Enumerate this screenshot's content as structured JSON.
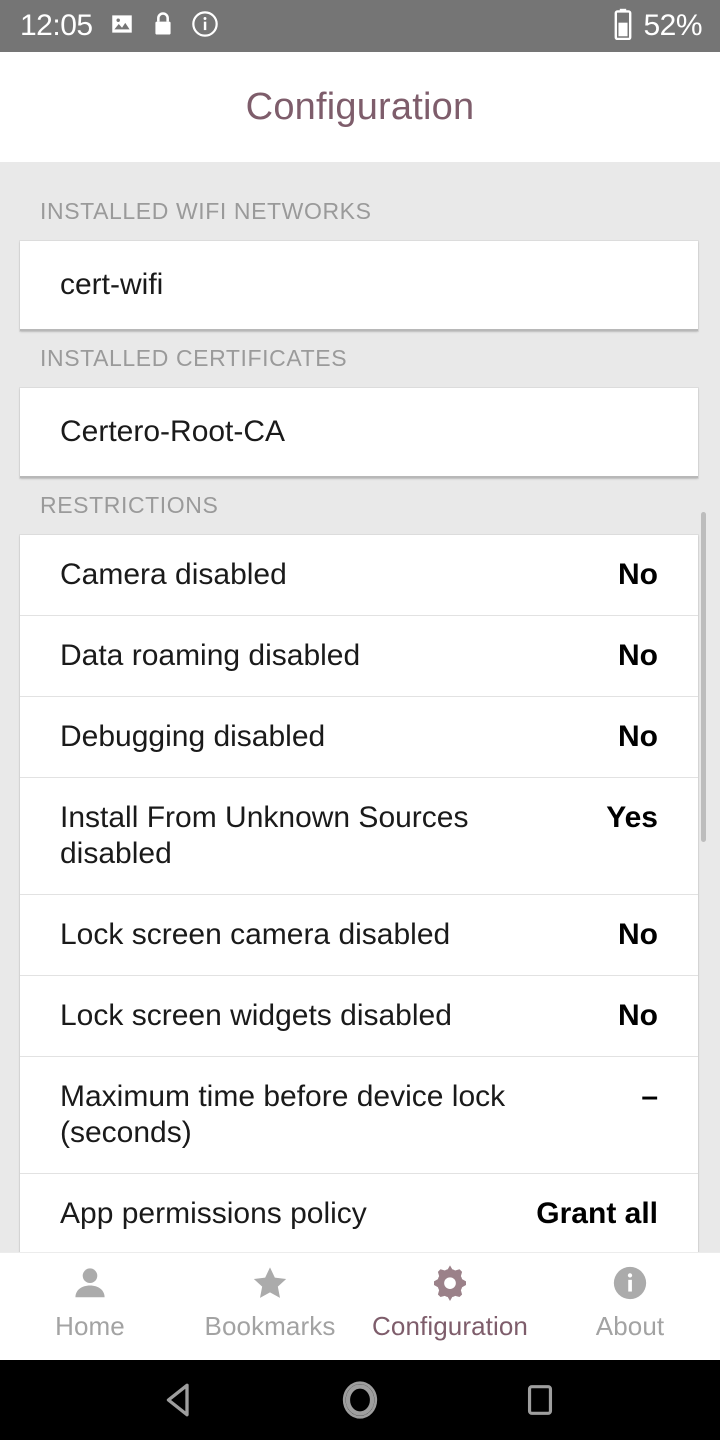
{
  "status_bar": {
    "time": "12:05",
    "battery_percent": "52%",
    "icons": [
      "image-icon",
      "lock-icon",
      "info-icon",
      "battery-icon"
    ],
    "background": "#757575",
    "foreground": "#ffffff"
  },
  "header": {
    "title": "Configuration",
    "accent_color": "#7e5d6b"
  },
  "sections": [
    {
      "header": "INSTALLED WIFI NETWORKS",
      "type": "simple",
      "items": [
        "cert-wifi"
      ]
    },
    {
      "header": "INSTALLED CERTIFICATES",
      "type": "simple",
      "items": [
        "Certero-Root-CA"
      ]
    },
    {
      "header": "RESTRICTIONS",
      "type": "key-value",
      "rows": [
        {
          "label": "Camera disabled",
          "value": "No"
        },
        {
          "label": "Data roaming disabled",
          "value": "No"
        },
        {
          "label": "Debugging disabled",
          "value": "No"
        },
        {
          "label": "Install From Unknown Sources disabled",
          "value": "Yes"
        },
        {
          "label": "Lock screen camera disabled",
          "value": "No"
        },
        {
          "label": "Lock screen widgets disabled",
          "value": "No"
        },
        {
          "label": "Maximum time before device lock (seconds)",
          "value": "–"
        },
        {
          "label": "App permissions policy",
          "value": "Grant all"
        }
      ]
    }
  ],
  "tab_bar": {
    "active_color": "#7e5d6b",
    "inactive_color": "#a3a3a3",
    "tabs": [
      {
        "label": "Home",
        "icon": "person-icon",
        "active": false
      },
      {
        "label": "Bookmarks",
        "icon": "star-icon",
        "active": false
      },
      {
        "label": "Configuration",
        "icon": "gear-icon",
        "active": true
      },
      {
        "label": "About",
        "icon": "info-circle-icon",
        "active": false
      }
    ]
  },
  "nav_bar": {
    "buttons": [
      {
        "name": "back",
        "icon": "back-triangle-icon"
      },
      {
        "name": "home",
        "icon": "home-circle-icon"
      },
      {
        "name": "recents",
        "icon": "recents-square-icon"
      }
    ]
  }
}
